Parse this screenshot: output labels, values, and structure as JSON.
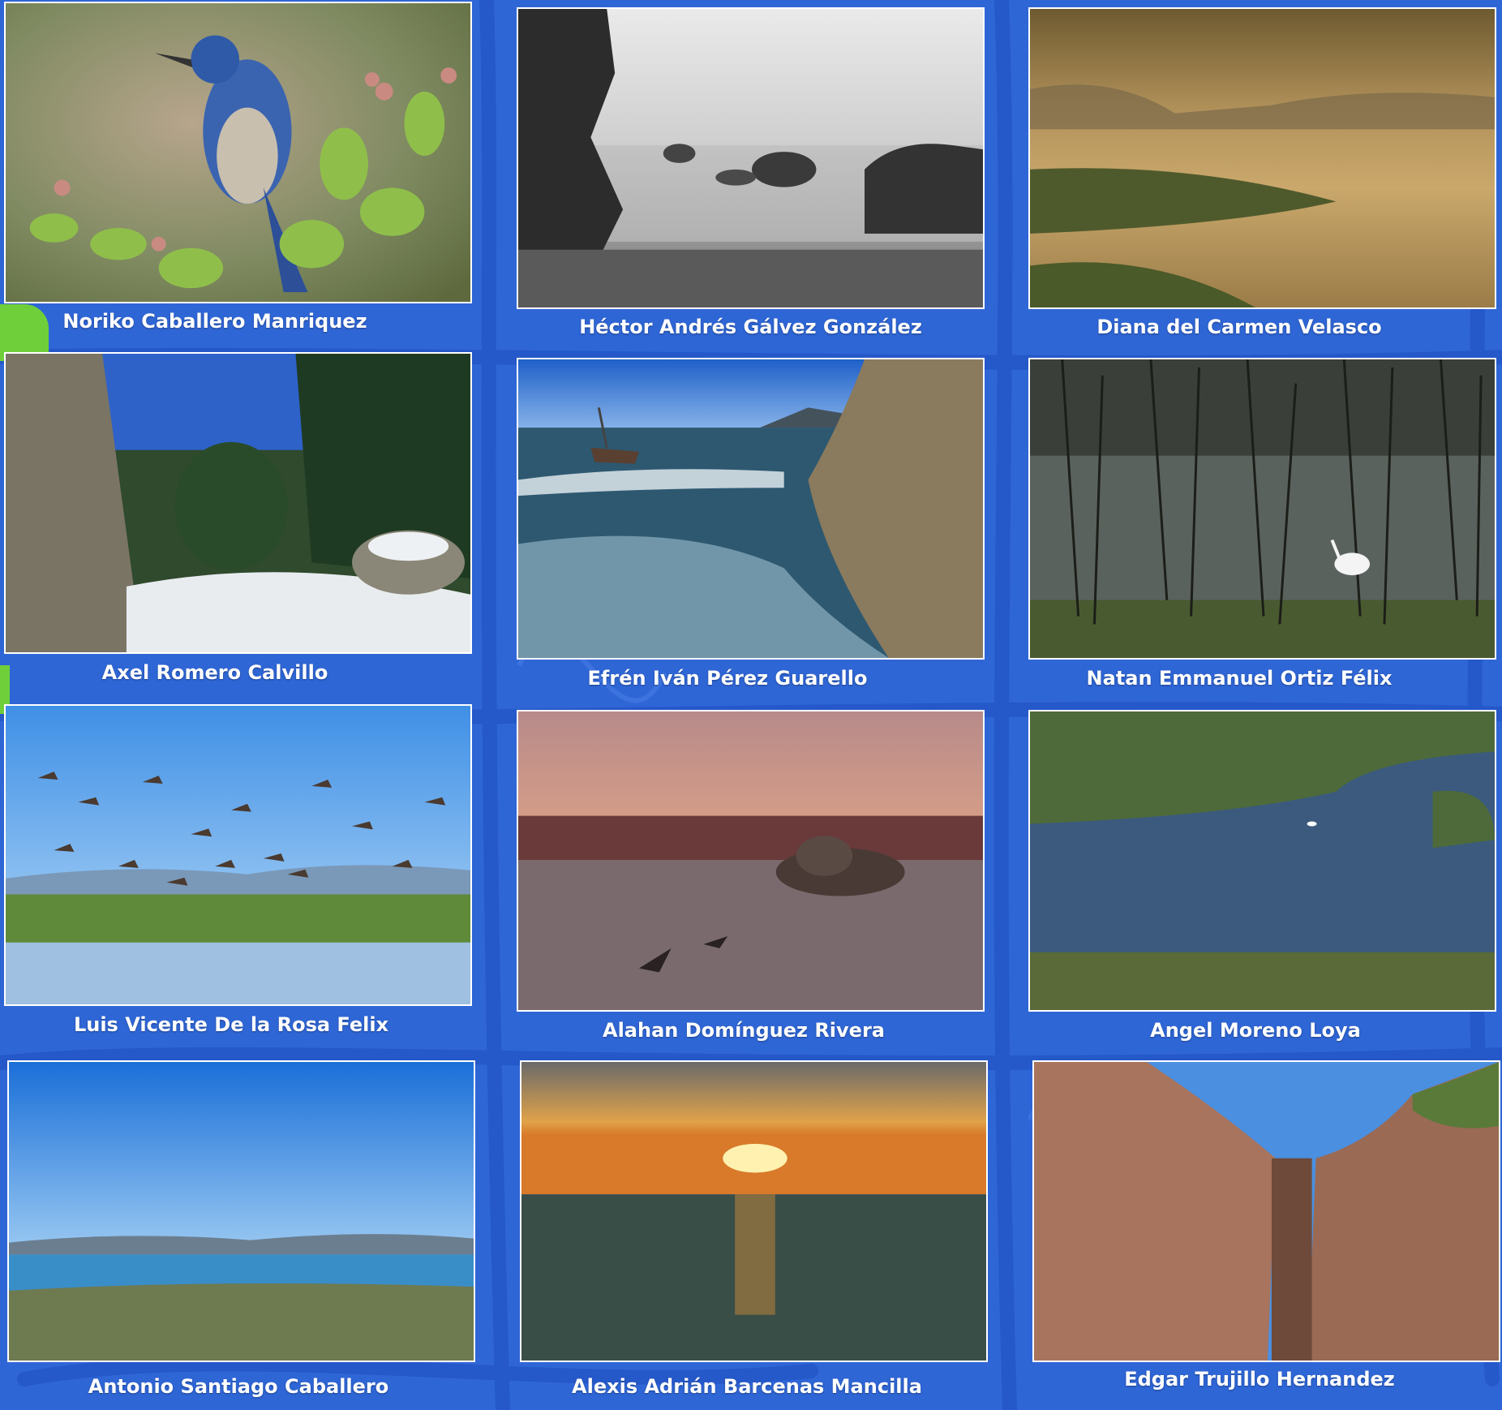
{
  "gallery": {
    "photos": [
      {
        "photographer": "Noriko  Caballero Manriquez"
      },
      {
        "photographer": "Héctor Andrés Gálvez González"
      },
      {
        "photographer": "Diana del Carmen Velasco"
      },
      {
        "photographer": "Axel Romero Calvillo"
      },
      {
        "photographer": "Efrén Iván Pérez Guarello"
      },
      {
        "photographer": "Natan Emmanuel Ortiz Félix"
      },
      {
        "photographer": "Luis Vicente De la Rosa Felix"
      },
      {
        "photographer": "Alahan Domínguez Rivera"
      },
      {
        "photographer": "Angel Moreno Loya"
      },
      {
        "photographer": "Antonio  Santiago Caballero"
      },
      {
        "photographer": "Alexis Adrián Barcenas Mancilla"
      },
      {
        "photographer": "Edgar Trujillo Hernandez"
      }
    ]
  },
  "colors": {
    "background": "#2f66d6",
    "accent_green": "#6fcf3a",
    "caption_text": "#ffffff"
  }
}
